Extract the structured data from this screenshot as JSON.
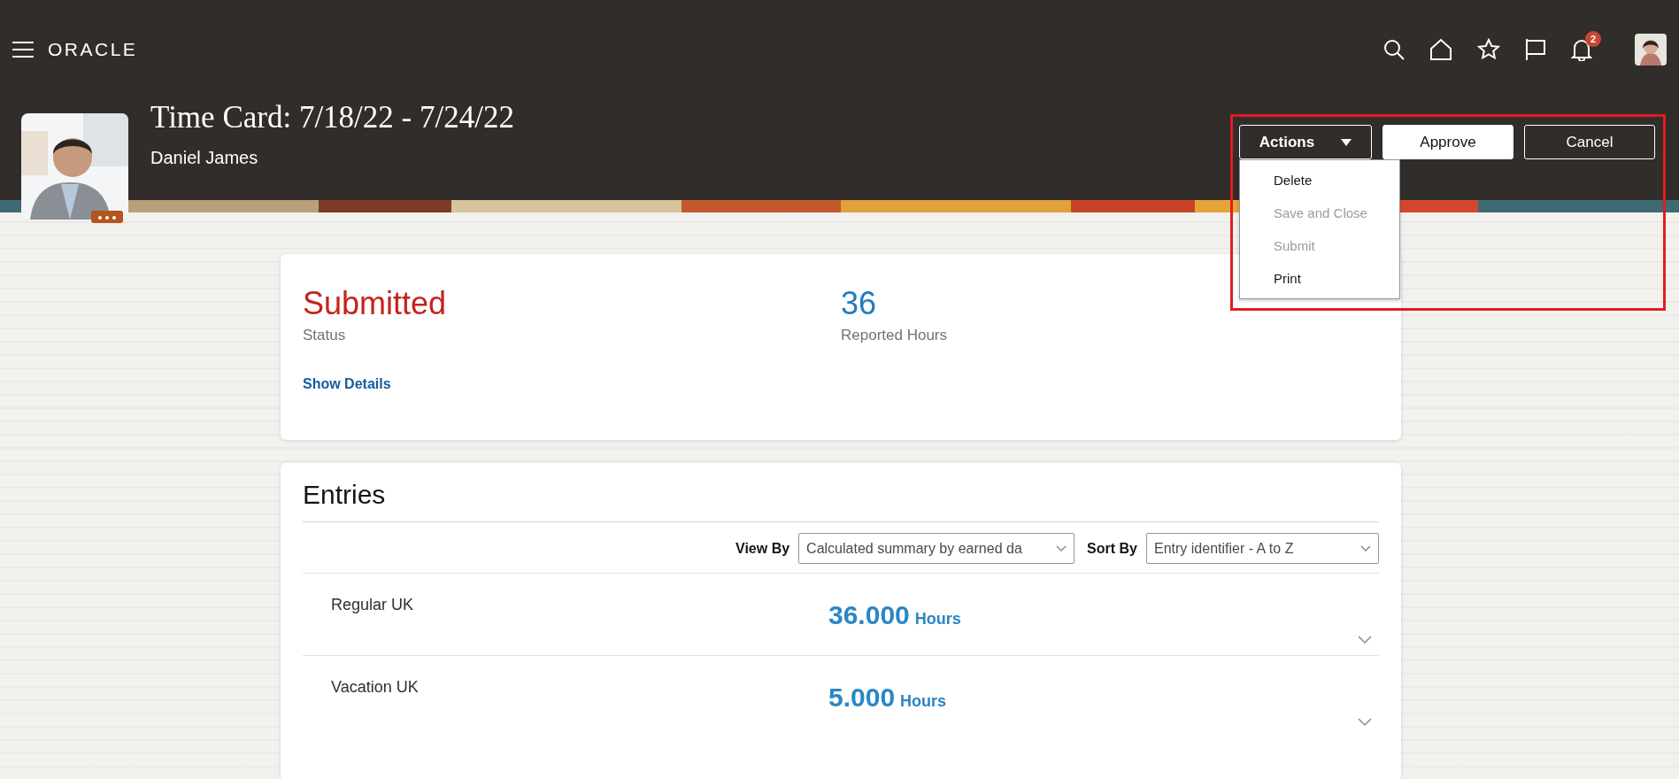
{
  "header": {
    "logo": "ORACLE",
    "notification_count": "2"
  },
  "page": {
    "title": "Time Card: 7/18/22 - 7/24/22",
    "subtitle": "Daniel James"
  },
  "actions": {
    "label": "Actions",
    "expanded": true,
    "menu": [
      {
        "label": "Delete",
        "disabled": false
      },
      {
        "label": "Save and Close",
        "disabled": true
      },
      {
        "label": "Submit",
        "disabled": true
      },
      {
        "label": "Print",
        "disabled": false
      }
    ]
  },
  "buttons": [
    {
      "label": "Approve",
      "kind": "primary"
    },
    {
      "label": "Cancel",
      "kind": "outline"
    }
  ],
  "summary": {
    "metrics": [
      {
        "value": "Submitted",
        "label": "Status",
        "kind": "status"
      },
      {
        "value": "36",
        "label": "Reported Hours",
        "kind": "count"
      }
    ],
    "link": "Show Details"
  },
  "entries": {
    "title": "Entries",
    "filters": [
      {
        "label": "View By",
        "value": "Calculated summary by earned da"
      },
      {
        "label": "Sort By",
        "value": "Entry identifier - A to Z"
      }
    ],
    "rows": [
      {
        "name": "Regular UK",
        "amount": "36.000",
        "unit": "Hours",
        "expanded": false
      },
      {
        "name": "Vacation UK",
        "amount": "5.000",
        "unit": "Hours",
        "expanded": false
      }
    ]
  }
}
